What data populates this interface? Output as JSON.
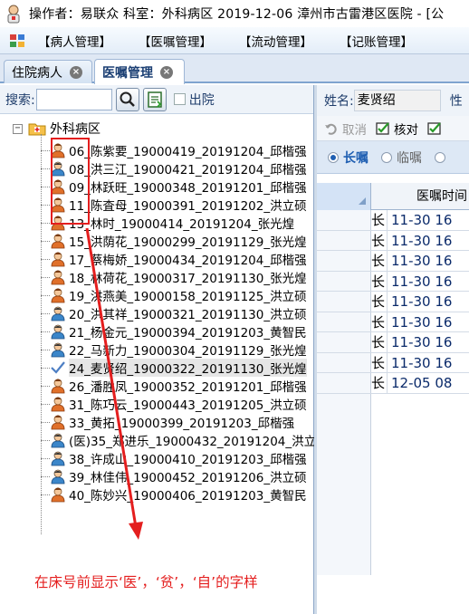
{
  "window": {
    "title": "操作者：易联众  科室：外科病区  2019-12-06  漳州市古雷港区医院 - [公"
  },
  "menu": {
    "items": [
      "【病人管理】",
      "【医嘱管理】",
      "【流动管理】",
      "【记账管理】"
    ]
  },
  "tabs": [
    {
      "label": "住院病人",
      "active": false
    },
    {
      "label": "医嘱管理",
      "active": true
    }
  ],
  "left": {
    "search_label": "搜索:",
    "search_value": "",
    "discharged_label": "出院",
    "root_label": "外科病区",
    "patients": [
      {
        "text": "06_陈紫要_19000419_20191204_邱楷强",
        "icon": "female-patient-icon"
      },
      {
        "text": "08_洪三江_19000421_20191204_邱楷强",
        "icon": "male-patient-icon"
      },
      {
        "text": "09_林跃旺_19000348_20191201_邱楷强",
        "icon": "female-patient-icon"
      },
      {
        "text": "11_陈査母_19000391_20191202_洪立硕",
        "icon": "female-patient-icon"
      },
      {
        "text": "13_林时_19000414_20191204_张光煌",
        "icon": "female-patient-icon"
      },
      {
        "text": "15_洪荫花_19000299_20191129_张光煌",
        "icon": "female-patient-icon"
      },
      {
        "text": "17_蔡梅娇_19000434_20191204_邱楷强",
        "icon": "female-patient-icon"
      },
      {
        "text": "18_林荷花_19000317_20191130_张光煌",
        "icon": "female-patient-icon"
      },
      {
        "text": "19_洪燕美_19000158_20191125_洪立硕",
        "icon": "female-patient-icon"
      },
      {
        "text": "20_洪其祥_19000321_20191130_洪立硕",
        "icon": "male-patient-icon"
      },
      {
        "text": "21_杨金元_19000394_20191203_黄智民",
        "icon": "male-patient-icon"
      },
      {
        "text": "22_马新力_19000304_20191129_张光煌",
        "icon": "male-patient-icon"
      },
      {
        "text": "24_麦贤绍_19000322_20191130_张光煌",
        "icon": "check-icon",
        "selected": true
      },
      {
        "text": "26_潘胜凤_19000352_20191201_邱楷强",
        "icon": "female-patient-icon"
      },
      {
        "text": "31_陈巧云_19000443_20191205_洪立硕",
        "icon": "female-patient-icon"
      },
      {
        "text": "33_黄拓_19000399_20191203_邱楷强",
        "icon": "female-patient-icon"
      },
      {
        "text": "(医)35_郑进乐_19000432_20191204_洪立",
        "icon": "male-patient-icon"
      },
      {
        "text": "38_许成山_19000410_20191203_邱楷强",
        "icon": "male-patient-icon"
      },
      {
        "text": "39_林佳伟_19000452_20191206_洪立硕",
        "icon": "male-patient-icon"
      },
      {
        "text": "40_陈妙兴_19000406_20191203_黄智民",
        "icon": "female-patient-icon"
      }
    ],
    "annotation": "在床号前显示‘医’，‘贫’，‘自’的字样"
  },
  "right": {
    "name_label": "姓名:",
    "name_value": "麦贤绍",
    "next_label": "性",
    "toolbar": {
      "cancel": "取消",
      "verify": "核对"
    },
    "radios": {
      "long": "长嘱",
      "temp": "临嘱"
    },
    "grid": {
      "header": "医嘱时间",
      "rows": [
        {
          "type": "长",
          "time": "11-30 16"
        },
        {
          "type": "长",
          "time": "11-30 16"
        },
        {
          "type": "长",
          "time": "11-30 16"
        },
        {
          "type": "长",
          "time": "11-30 16"
        },
        {
          "type": "长",
          "time": "11-30 16"
        },
        {
          "type": "长",
          "time": "11-30 16"
        },
        {
          "type": "长",
          "time": "11-30 16"
        },
        {
          "type": "长",
          "time": "11-30 16"
        },
        {
          "type": "长",
          "time": "12-05 08"
        }
      ]
    }
  },
  "colors": {
    "annotation_red": "#e41e1e",
    "accent_blue": "#1f5fb2"
  }
}
